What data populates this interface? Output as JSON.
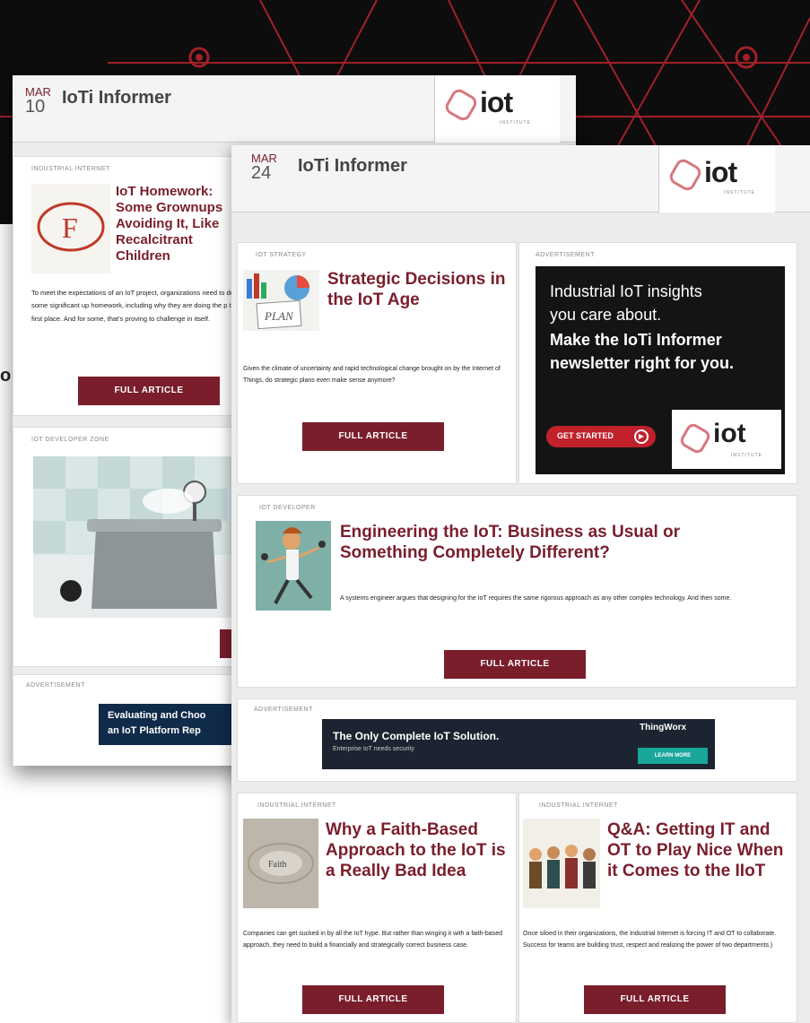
{
  "colors": {
    "brand": "#7a1e2c",
    "banner": "#0d0d0d",
    "accent": "#d7787e"
  },
  "banner": {
    "partial_text": "o"
  },
  "back": {
    "month": "MAR",
    "day": "10",
    "title": "IoTi Informer",
    "logo": {
      "word": "iot",
      "sub": "INSTITUTE"
    },
    "article1": {
      "tag": "INDUSTRIAL INTERNET",
      "headline": "IoT Homework: Some Grownups Avoiding It, Like Recalcitrant Children",
      "summary": "To meet the expectations of an IoT project, organizations need to do some significant up homework, including why they are doing the p the first place. And for some, that's proving to challenge in itself.",
      "button": "FULL ARTICLE",
      "icon": "graded-f-paper-icon"
    },
    "article2": {
      "tag": "IOT DEVELOPER ZONE",
      "icon": "pressure-cooker-illustration"
    },
    "ad": {
      "tag": "ADVERTISEMENT",
      "line1": "Evaluating and Choo",
      "line2": "an IoT Platform Rep"
    }
  },
  "front": {
    "month": "MAR",
    "day": "24",
    "title": "IoTi Informer",
    "logo": {
      "word": "iot",
      "sub": "INSTITUTE"
    },
    "strategy": {
      "tag": "IOT STRATEGY",
      "headline": "Strategic Decisions in the IoT Age",
      "summary": "Given the climate of uncertainty and rapid technological change brought on by the Internet of Things, do strategic plans even make sense anymore?",
      "button": "FULL ARTICLE",
      "icon": "plan-charts-icon",
      "plan_label": "PLAN"
    },
    "ad_main": {
      "tag": "ADVERTISEMENT",
      "line1": "Industrial IoT insights",
      "line2": "you care about.",
      "line3": "Make the IoTi Informer",
      "line4": "newsletter right for you.",
      "cta": "GET STARTED",
      "logo_word": "iot",
      "logo_sub": "INSTITUTE"
    },
    "developer": {
      "tag": "IOT DEVELOPER",
      "headline": "Engineering the IoT: Business as Usual or Something Completely Different?",
      "summary": "A systems engineer argues that designing for the IoT requires the same rigorous approach as any other complex technology. And then some.",
      "button": "FULL ARTICLE",
      "icon": "engineer-juggling-illustration"
    },
    "ad_banner": {
      "tag": "ADVERTISEMENT",
      "line1": "The Only Complete IoT Solution.",
      "line2": "Enterprise IoT needs security",
      "brand": "ThingWorx",
      "cta": "LEARN MORE"
    },
    "faith": {
      "tag": "INDUSTRIAL INTERNET",
      "headline": "Why a Faith-Based Approach to the IoT is a Really Bad Idea",
      "summary": "Companies can get sucked in by all the IoT hype. But rather than winging it with a faith-based approach, they need to build a financially and strategically correct business case.",
      "button": "FULL ARTICLE",
      "icon": "faith-stone-icon",
      "stone_label": "Faith"
    },
    "qa": {
      "tag": "INDUSTRIAL INTERNET",
      "headline": "Q&A: Getting IT and OT to Play Nice When it Comes to the IIoT",
      "summary": "Once siloed in their organizations, the Industrial Internet is forcing IT and OT to collaborate. Success for teams are building trust, respect and realizing the power of two departments.)",
      "button": "FULL ARTICLE",
      "icon": "team-people-illustration"
    }
  }
}
